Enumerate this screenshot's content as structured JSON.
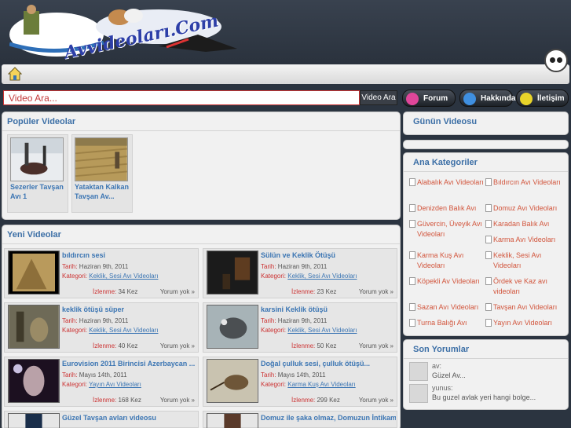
{
  "header": {
    "logo_text": "Avvideoları.Com"
  },
  "search": {
    "placeholder": "Video Ara...",
    "button_label": "Video Ara"
  },
  "nav": [
    {
      "label": "Forum",
      "color": "#e0469a"
    },
    {
      "label": "Hakkında",
      "color": "#3f8fe0"
    },
    {
      "label": "İletişim",
      "color": "#e8d42a"
    }
  ],
  "popular": {
    "title": "Popüler Videolar",
    "items": [
      {
        "title": "Sezerler Tavşan Avı 1"
      },
      {
        "title": "Yataktan Kalkan Tavşan Av..."
      }
    ]
  },
  "new_videos": {
    "title": "Yeni Videolar",
    "labels": {
      "date": "Tarih:",
      "category": "Kategori:",
      "views": "İzlenme:",
      "views_unit": "Kez"
    },
    "items": [
      {
        "title": "bıldırcın sesi",
        "date": "Haziran 9th, 2011",
        "category": "Keklik, Sesi Avı Videoları",
        "views": "34",
        "comments": "Yorum yok »"
      },
      {
        "title": "Sülün ve Keklik Ötüşü",
        "date": "Haziran 9th, 2011",
        "category": "Keklik, Sesi Avı Videoları",
        "views": "23",
        "comments": "Yorum yok »"
      },
      {
        "title": "keklik ötüşü süper",
        "date": "Haziran 9th, 2011",
        "category": "Keklik, Sesi Avı Videoları",
        "views": "40",
        "comments": "Yorum yok »"
      },
      {
        "title": "karsini Keklik ötüşü",
        "date": "Haziran 9th, 2011",
        "category": "Keklik, Sesi Avı Videoları",
        "views": "50",
        "comments": "Yorum yok »"
      },
      {
        "title": "Eurovision 2011 Birincisi Azerbaycan ...",
        "date": "Mayıs 14th, 2011",
        "category": "Yayın Avı Videoları",
        "views": "168",
        "comments": "Yorum yok »"
      },
      {
        "title": "Doğal çulluk sesi, çulluk ötüşü...",
        "date": "Mayıs 14th, 2011",
        "category": "Karma Kuş Avı Videoları",
        "views": "299",
        "comments": "Yorum yok »"
      },
      {
        "title": "Güzel Tavşan avları videosu",
        "date": "",
        "category": "",
        "views": "",
        "comments": ""
      },
      {
        "title": "Domuz ile şaka olmaz, Domuzun İntikam...",
        "date": "",
        "category": "",
        "views": "",
        "comments": ""
      }
    ]
  },
  "video_of_day": {
    "title": "Günün Videosu"
  },
  "categories": {
    "title": "Ana Kategoriler",
    "items": [
      "Alabalık Avı Videoları",
      "Bıldırcın Avı Videoları",
      "Denizden Balık Avı",
      "Domuz Avı Videoları",
      "Güvercin, Üveyik Avı Videoları",
      "Karadan Balık Avı",
      "",
      "Karma Avı Videoları",
      "Karma Kuş Avı Videoları",
      "Keklik, Sesi Avı Videoları",
      "Köpekli Av Videoları",
      "Ördek ve Kaz avı videoları",
      "Sazan Avı Videoları",
      "Tavşan Avı Videoları",
      "Turna Balığı Avı",
      "Yayın Avı Videoları"
    ]
  },
  "recent_comments": {
    "title": "Son Yorumlar",
    "items": [
      {
        "author": "av:",
        "text": "Güzel Av..."
      },
      {
        "author": "yunus:",
        "text": "Bu guzel avlak yeri hangi bolge..."
      }
    ]
  }
}
